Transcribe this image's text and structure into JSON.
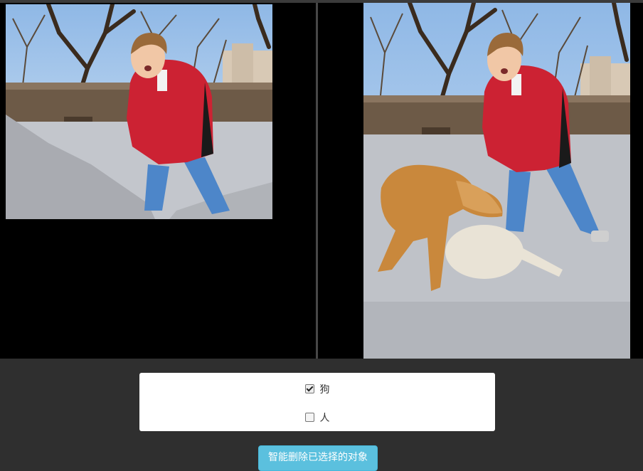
{
  "options": [
    {
      "label": "狗",
      "checked": true
    },
    {
      "label": "人",
      "checked": false
    }
  ],
  "actions": {
    "remove_button_label": "智能删除已选择的对象"
  },
  "colors": {
    "background": "#2f2f2f",
    "image_panel": "#000000",
    "button": "#5bc0de",
    "card": "#ffffff"
  }
}
